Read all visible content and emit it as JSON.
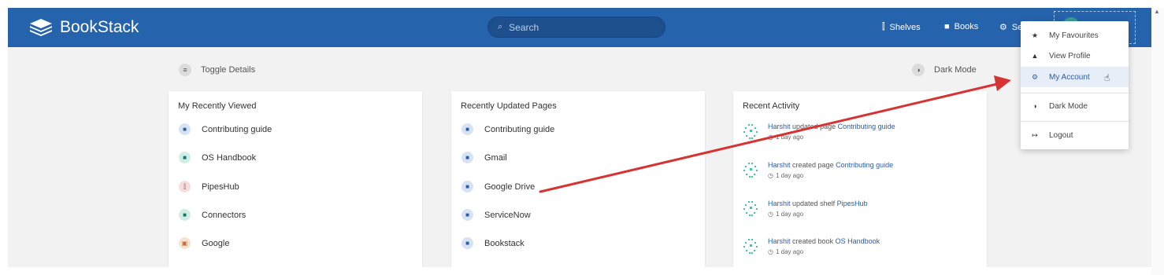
{
  "header": {
    "app_name": "BookStack",
    "search_placeholder": "Search",
    "nav": {
      "shelves": "Shelves",
      "books": "Books",
      "settings": "Se"
    }
  },
  "toolbar": {
    "toggle_details": "Toggle Details",
    "dark_mode": "Dark Mode"
  },
  "recently_viewed": {
    "title": "My Recently Viewed",
    "items": [
      {
        "label": "Contributing guide",
        "type": "page"
      },
      {
        "label": "OS Handbook",
        "type": "book"
      },
      {
        "label": "PipesHub",
        "type": "shelf"
      },
      {
        "label": "Connectors",
        "type": "book"
      },
      {
        "label": "Google",
        "type": "chapter"
      }
    ]
  },
  "recently_updated": {
    "title": "Recently Updated Pages",
    "items": [
      {
        "label": "Contributing guide"
      },
      {
        "label": "Gmail"
      },
      {
        "label": "Google Drive"
      },
      {
        "label": "ServiceNow"
      },
      {
        "label": "Bookstack"
      }
    ]
  },
  "recent_activity": {
    "title": "Recent Activity",
    "items": [
      {
        "user": "Harshit",
        "action": "updated page",
        "target": "Contributing guide",
        "time": "1 day ago"
      },
      {
        "user": "Harshit",
        "action": "created page",
        "target": "Contributing guide",
        "time": "1 day ago"
      },
      {
        "user": "Harshit",
        "action": "updated shelf",
        "target": "PipesHub",
        "time": "1 day ago"
      },
      {
        "user": "Harshit",
        "action": "created book",
        "target": "OS Handbook",
        "time": "1 day ago"
      }
    ]
  },
  "user_menu": {
    "items": [
      {
        "label": "My Favourites",
        "icon": "star-icon"
      },
      {
        "label": "View Profile",
        "icon": "user-icon"
      },
      {
        "label": "My Account",
        "icon": "user-cog-icon",
        "active": true
      },
      {
        "label": "Dark Mode",
        "icon": "moon-icon"
      },
      {
        "label": "Logout",
        "icon": "logout-icon"
      }
    ]
  },
  "colors": {
    "header": "#2663ad",
    "link": "#2a5da7",
    "annotation_arrow": "#d63333"
  }
}
